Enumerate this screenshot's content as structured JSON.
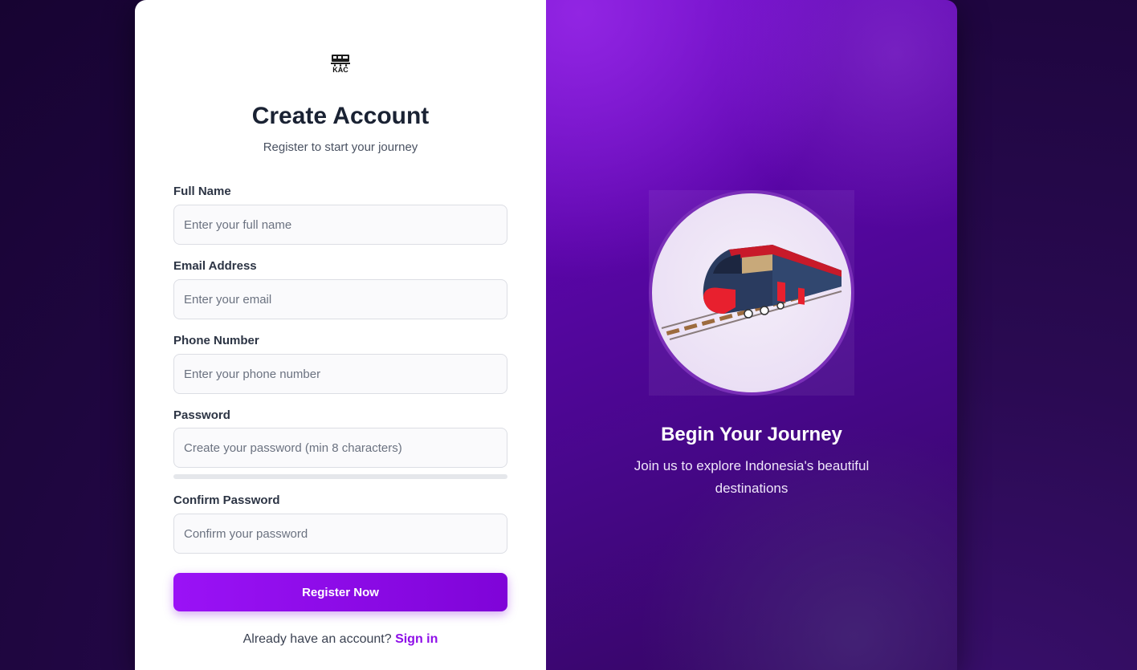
{
  "logo": {
    "text": "KAC",
    "icon": "train-icon"
  },
  "form": {
    "title": "Create Account",
    "subtitle": "Register to start your journey",
    "full_name": {
      "label": "Full Name",
      "placeholder": "Enter your full name"
    },
    "email": {
      "label": "Email Address",
      "placeholder": "Enter your email"
    },
    "phone": {
      "label": "Phone Number",
      "placeholder": "Enter your phone number"
    },
    "password": {
      "label": "Password",
      "placeholder": "Create your password (min 8 characters)",
      "strength": 0
    },
    "confirm_password": {
      "label": "Confirm Password",
      "placeholder": "Confirm your password"
    },
    "submit_label": "Register Now",
    "signin_prompt": "Already have an account?",
    "signin_link": "Sign in"
  },
  "hero": {
    "title": "Begin Your Journey",
    "text": "Join us to explore Indonesia's beautiful destinations",
    "image": "train-illustration"
  },
  "colors": {
    "accent": "#8e0ee8",
    "button_start": "#9a12f6",
    "button_end": "#7f04d8",
    "panel": "#5a05a8",
    "background": "#1f0640"
  }
}
